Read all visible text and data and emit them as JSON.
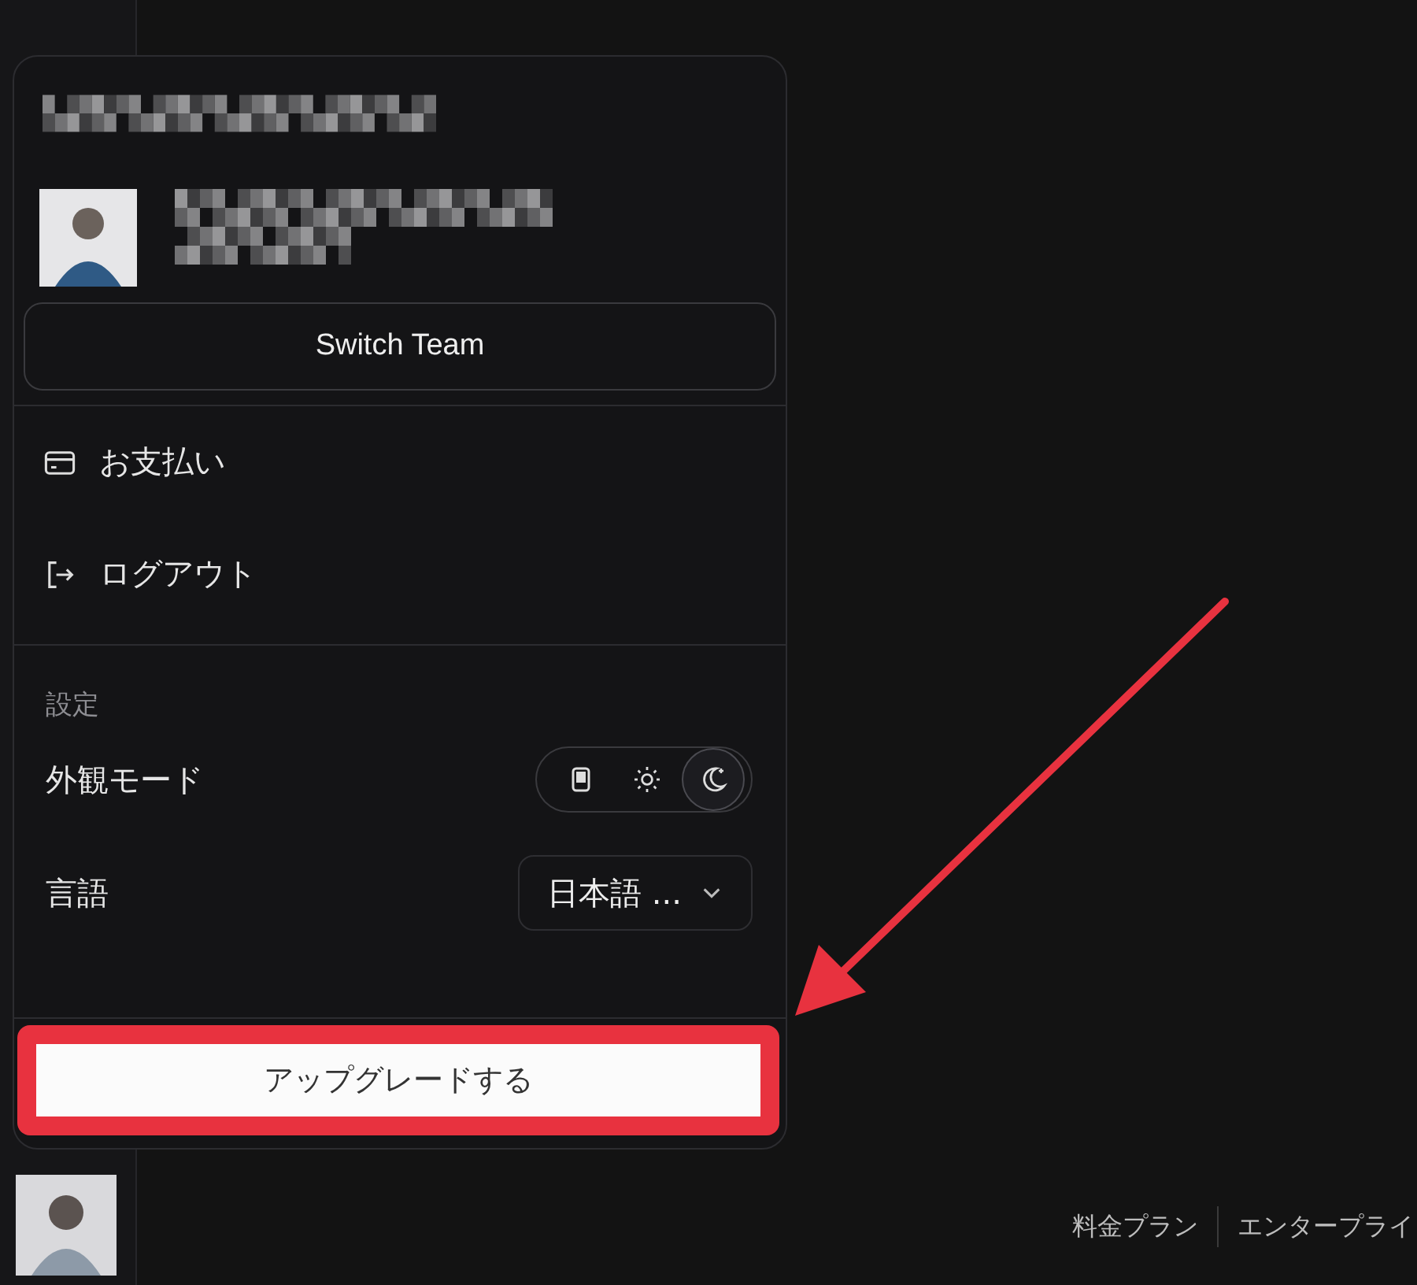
{
  "account_menu": {
    "switch_team": "Switch Team",
    "items": [
      {
        "kind": "billing",
        "label": "お支払い"
      },
      {
        "kind": "logout",
        "label": "ログアウト"
      }
    ],
    "settings": {
      "heading": "設定",
      "appearance": {
        "label": "外観モード",
        "modes": [
          {
            "kind": "system",
            "selected": false
          },
          {
            "kind": "light",
            "selected": false
          },
          {
            "kind": "dark",
            "selected": true
          }
        ]
      },
      "language": {
        "label": "言語",
        "value": "日本語 ..."
      }
    },
    "upgrade_button": "アップグレードする",
    "highlighted": true
  },
  "footer_links": [
    "料金プラン",
    "エンタープライ"
  ],
  "annotation": {
    "arrow": true
  }
}
